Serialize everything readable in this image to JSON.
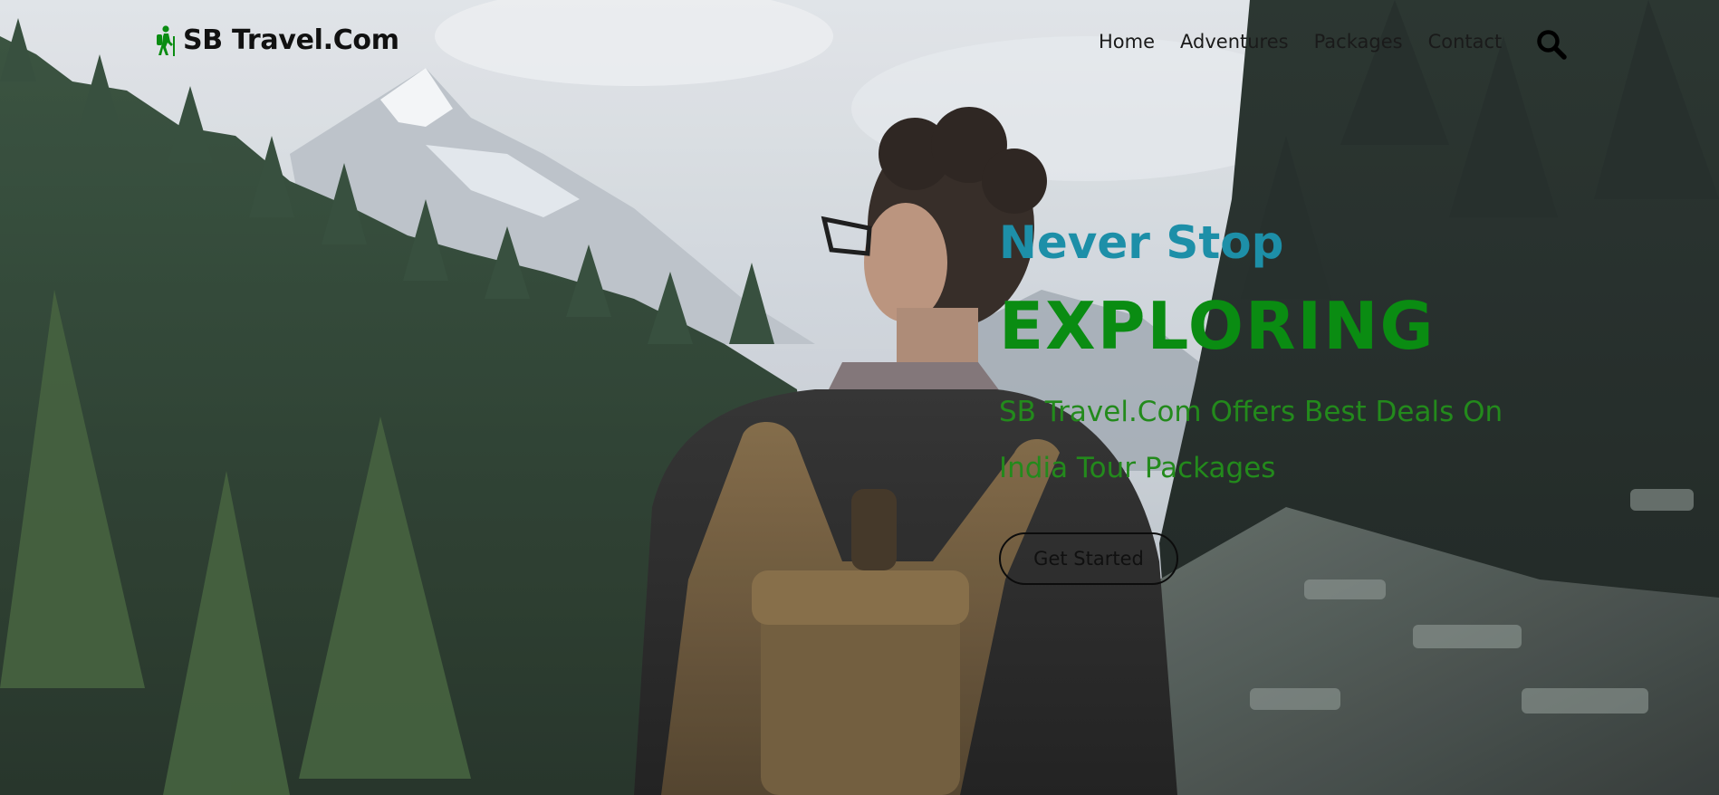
{
  "brand": {
    "name": "SB Travel.Com",
    "icon": "hiking-person-icon"
  },
  "nav": {
    "items": [
      {
        "label": "Home"
      },
      {
        "label": "Adventures"
      },
      {
        "label": "Packages"
      },
      {
        "label": "Contact"
      }
    ],
    "search_icon": "search-icon"
  },
  "hero": {
    "eyebrow": "Never Stop",
    "title": "EXPLORING",
    "description": "SB Travel.Com Offers Best Deals On India Tour Packages",
    "cta_label": "Get Started"
  },
  "colors": {
    "accent_teal": "#1d8fa8",
    "accent_green": "#0a8c12",
    "text_dark": "#111111"
  }
}
